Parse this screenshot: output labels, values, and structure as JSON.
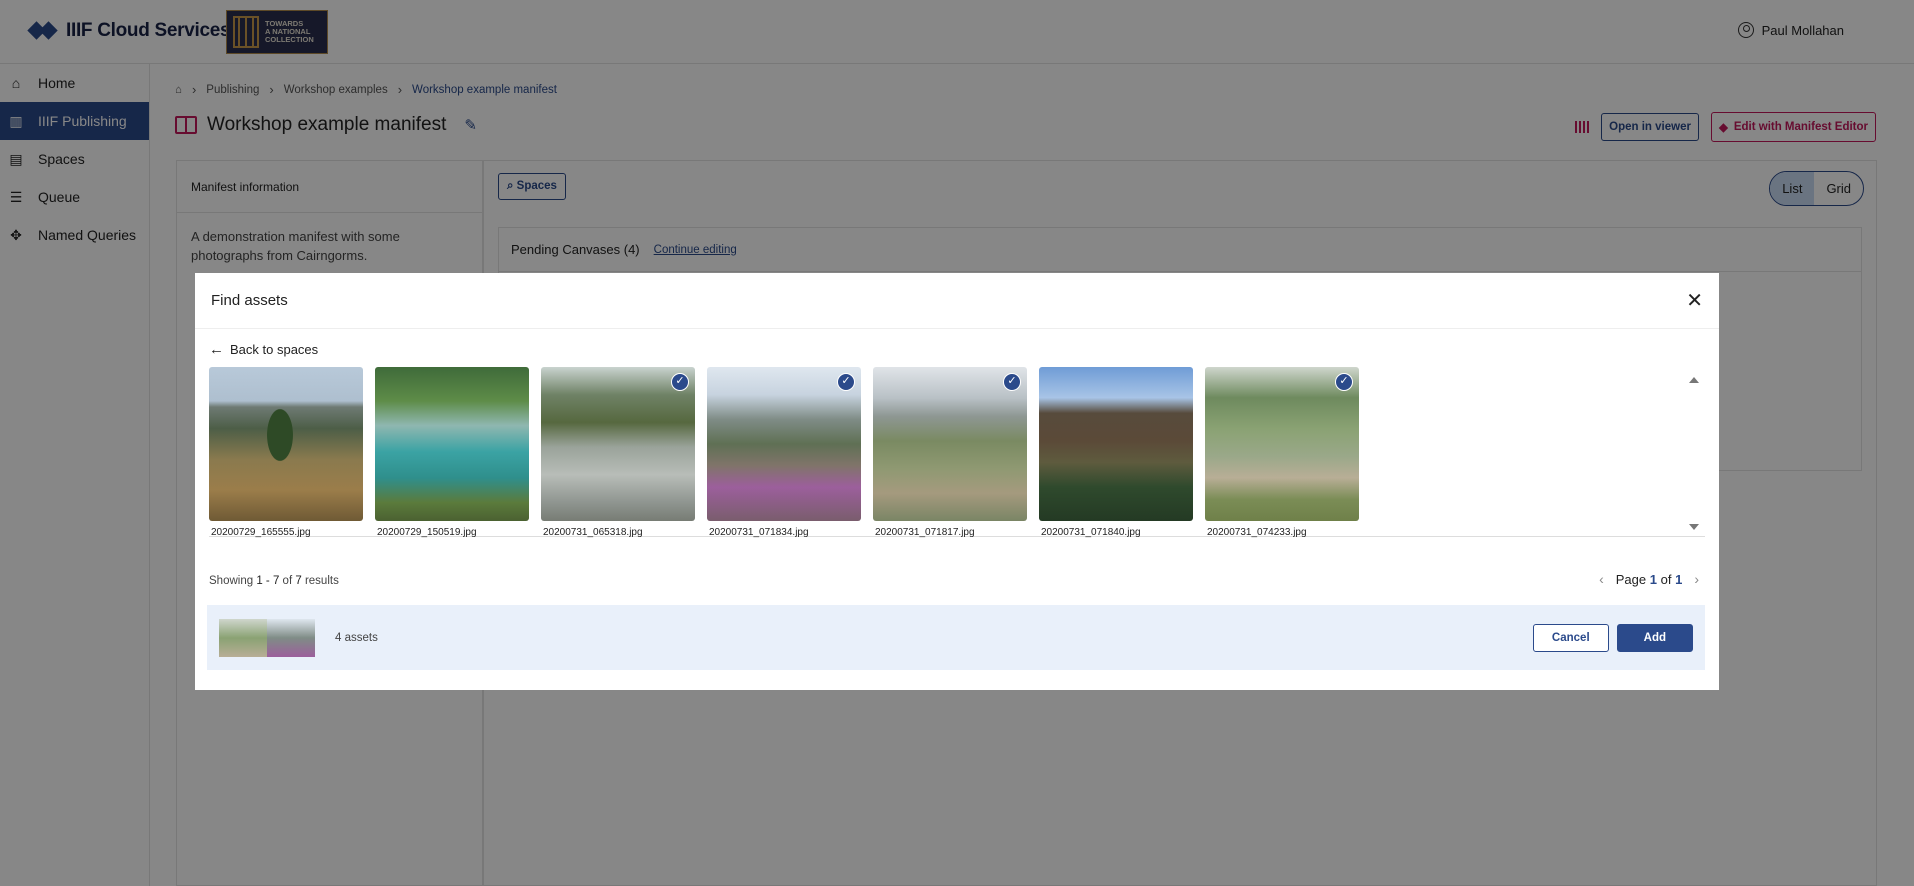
{
  "header": {
    "app_name": "IIIF Cloud Services",
    "collection_badge": [
      "TOWARDS",
      "A NATIONAL",
      "COLLECTION"
    ],
    "user_name": "Paul Mollahan"
  },
  "sidebar": {
    "items": [
      {
        "label": "Home",
        "icon": "home-icon"
      },
      {
        "label": "IIIF Publishing",
        "icon": "publishing-icon"
      },
      {
        "label": "Spaces",
        "icon": "spaces-icon"
      },
      {
        "label": "Queue",
        "icon": "queue-icon"
      },
      {
        "label": "Named Queries",
        "icon": "named-queries-icon"
      }
    ]
  },
  "breadcrumb": {
    "items": [
      "Publishing",
      "Workshop examples",
      "Workshop example manifest"
    ]
  },
  "page": {
    "title": "Workshop example manifest",
    "open_viewer_label": "Open in viewer",
    "edit_label": "Edit with Manifest Editor"
  },
  "left_panel": {
    "header": "Manifest information",
    "description": "A demonstration manifest with some photographs from Cairngorms."
  },
  "right_panel": {
    "spaces_button": "Spaces",
    "view_list": "List",
    "view_grid": "Grid",
    "pending_label": "Pending Canvases (4)",
    "continue_label": "Continue editing"
  },
  "modal": {
    "title": "Find assets",
    "back_label": "Back to spaces",
    "assets": [
      {
        "name": "20200729_165555.jpg",
        "selected": false
      },
      {
        "name": "20200729_150519.jpg",
        "selected": false
      },
      {
        "name": "20200731_065318.jpg",
        "selected": true
      },
      {
        "name": "20200731_071834.jpg",
        "selected": true
      },
      {
        "name": "20200731_071817.jpg",
        "selected": true
      },
      {
        "name": "20200731_071840.jpg",
        "selected": false
      },
      {
        "name": "20200731_074233.jpg",
        "selected": true
      }
    ],
    "results": {
      "prefix": "Showing",
      "range": "1 - 7",
      "of": "of",
      "total": "7",
      "suffix": "results"
    },
    "pager": {
      "page_word": "Page",
      "current": "1",
      "of": "of",
      "total": "1"
    },
    "selection": {
      "count_label": "4 assets"
    },
    "cancel_label": "Cancel",
    "add_label": "Add"
  },
  "colors": {
    "primary": "#2b4a8b",
    "accent": "#c2185b",
    "selection_bg": "#e9f0fa",
    "overlay": "rgba(0,0,0,0.47)"
  }
}
